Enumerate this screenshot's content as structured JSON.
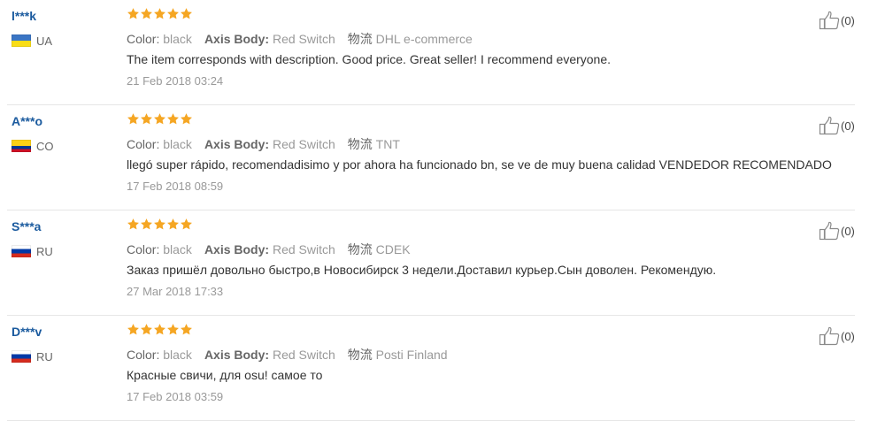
{
  "colors": {
    "username": "#1a5a9e",
    "star": "#f5a623",
    "muted": "#999999",
    "divider": "#e6e6e6"
  },
  "reviews": [
    {
      "user": "l***k",
      "country": "UA",
      "flag": "flag-ua",
      "rating": 5,
      "attributes": [
        {
          "key": "Color:",
          "value": "black"
        },
        {
          "key": "Axis Body:",
          "value": "Red Switch"
        },
        {
          "key": "物流",
          "value": "DHL e-commerce"
        }
      ],
      "text": "The item corresponds with description. Good price. Great seller! I recommend everyone.",
      "date": "21 Feb 2018 03:24",
      "helpful": "(0)"
    },
    {
      "user": "A***o",
      "country": "CO",
      "flag": "flag-co",
      "rating": 5,
      "attributes": [
        {
          "key": "Color:",
          "value": "black"
        },
        {
          "key": "Axis Body:",
          "value": "Red Switch"
        },
        {
          "key": "物流",
          "value": "TNT"
        }
      ],
      "text": "llegó super rápido, recomendadisimo y por ahora ha funcionado bn, se ve de muy buena calidad VENDEDOR RECOMENDADO",
      "date": "17 Feb 2018 08:59",
      "helpful": "(0)"
    },
    {
      "user": "S***a",
      "country": "RU",
      "flag": "flag-ru",
      "rating": 5,
      "attributes": [
        {
          "key": "Color:",
          "value": "black"
        },
        {
          "key": "Axis Body:",
          "value": "Red Switch"
        },
        {
          "key": "物流",
          "value": "CDEK"
        }
      ],
      "text": "Заказ пришёл довольно быстро,в Новосибирск 3 недели.Доставил курьер.Сын доволен. Рекомендую.",
      "date": "27 Mar 2018 17:33",
      "helpful": "(0)"
    },
    {
      "user": "D***v",
      "country": "RU",
      "flag": "flag-ru",
      "rating": 5,
      "attributes": [
        {
          "key": "Color:",
          "value": "black"
        },
        {
          "key": "Axis Body:",
          "value": "Red Switch"
        },
        {
          "key": "物流",
          "value": "Posti Finland"
        }
      ],
      "text": "Красные свичи, для osu! самое то",
      "date": "17 Feb 2018 03:59",
      "helpful": "(0)"
    }
  ]
}
